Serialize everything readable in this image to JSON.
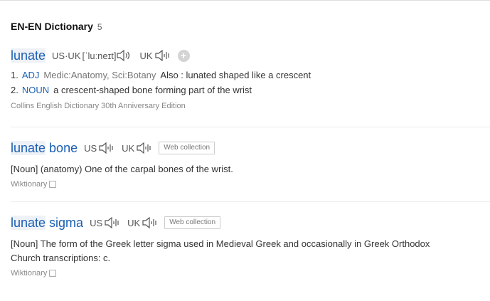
{
  "header": {
    "title": "EN-EN Dictionary",
    "count": "5"
  },
  "entries": [
    {
      "hl": "lunate",
      "rest": "",
      "pron_us": "US·UK",
      "ipa": "[ˈluːneɪt]",
      "pron_uk": "UK",
      "defs": [
        {
          "num": "1.",
          "pos": "ADJ",
          "cat": "Medic:Anatomy, Sci:Botany",
          "text": "Also : lunated shaped like a crescent"
        },
        {
          "num": "2.",
          "pos": "NOUN",
          "cat": "",
          "text": "a crescent-shaped bone forming part of the wrist"
        }
      ],
      "source": "Collins English Dictionary 30th Anniversary Edition"
    },
    {
      "hl": "lunate",
      "rest": " bone",
      "pron_us": "US",
      "pron_uk": "UK",
      "badge": "Web collection",
      "body": "[Noun] (anatomy) One of the carpal bones of the wrist.",
      "source": "Wiktionary"
    },
    {
      "hl": "lunate",
      "rest": " sigma",
      "pron_us": "US",
      "pron_uk": "UK",
      "badge": "Web collection",
      "body_line1": "[Noun] The form of the Greek letter sigma used in Medieval Greek and occasionally in Greek Orthodox",
      "body_line2": "Church transcriptions: c.",
      "source": "Wiktionary"
    }
  ],
  "add_button": "+",
  "colors": {
    "link": "#1a5fb4",
    "muted": "#888888",
    "divider": "#ececec"
  }
}
